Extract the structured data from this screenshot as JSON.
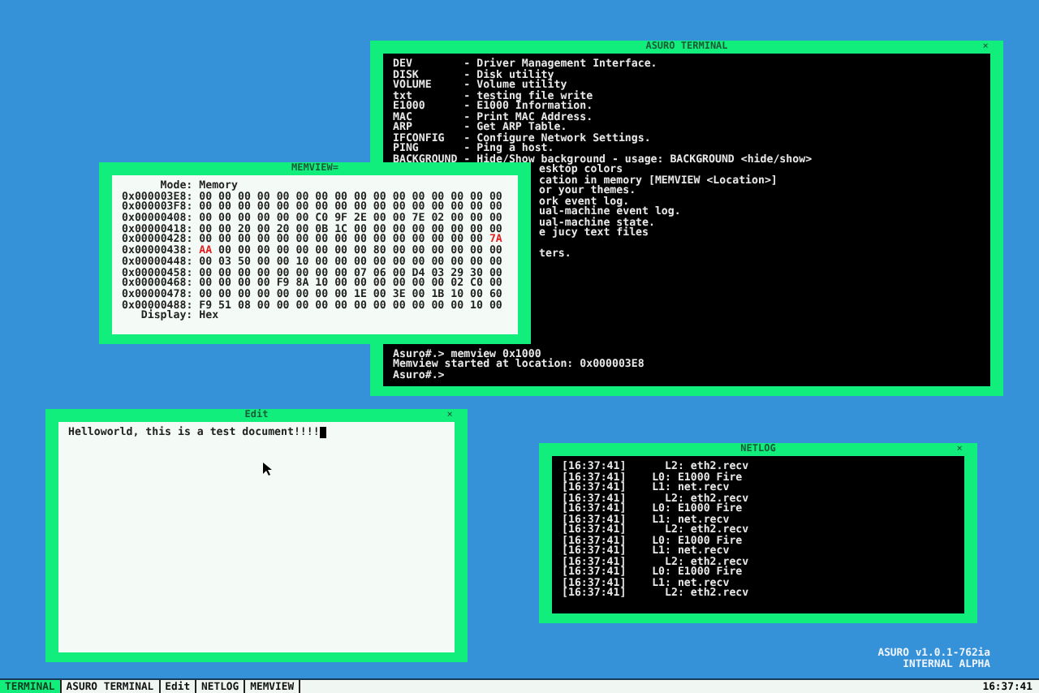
{
  "windows": [
    {
      "kind": "terminal",
      "title": "ASURO TERMINAL",
      "close": "×",
      "lines": [
        {
          "kind": "full",
          "text": "DEV        - Driver Management Interface."
        },
        {
          "kind": "full",
          "text": "DISK       - Disk utility"
        },
        {
          "kind": "full",
          "text": "VOLUME     - Volume utility"
        },
        {
          "kind": "full",
          "text": "txt        - testing file write"
        },
        {
          "kind": "full",
          "text": "E1000      - E1000 Information."
        },
        {
          "kind": "full",
          "text": "MAC        - Print MAC Address."
        },
        {
          "kind": "full",
          "text": "ARP        - Get ARP Table."
        },
        {
          "kind": "full",
          "text": "IFCONFIG   - Configure Network Settings."
        },
        {
          "kind": "full",
          "text": "PING       - Ping a host."
        },
        {
          "kind": "full",
          "text": "BACKGROUND - Hide/Show background - usage: BACKGROUND <hide/show>"
        },
        {
          "kind": "clipped",
          "text": "esktop colors"
        },
        {
          "kind": "clipped",
          "text": "cation in memory [MEMVIEW <Location>]"
        },
        {
          "kind": "clipped",
          "text": "or your themes."
        },
        {
          "kind": "clipped",
          "text": "ork event log."
        },
        {
          "kind": "clipped",
          "text": "ual-machine event log."
        },
        {
          "kind": "clipped",
          "text": "ual-machine state."
        },
        {
          "kind": "clipped",
          "text": "e jucy text files"
        },
        {
          "kind": "blank"
        },
        {
          "kind": "clipped",
          "text": "ters."
        }
      ],
      "prompt_lines": [
        "Asuro#.> memview 0x1000",
        "Memview started at location: 0x000003E8",
        "Asuro#.>"
      ]
    },
    {
      "kind": "memview",
      "title": "MEMVIEW=",
      "mode": {
        "label": "Mode:",
        "value": "Memory"
      },
      "rows": [
        {
          "address": "0x000003E8:",
          "bytes": [
            {
              "v": "00",
              "changed": false
            },
            {
              "v": "00",
              "changed": false
            },
            {
              "v": "00",
              "changed": false
            },
            {
              "v": "00",
              "changed": false
            },
            {
              "v": "00",
              "changed": false
            },
            {
              "v": "00",
              "changed": false
            },
            {
              "v": "00",
              "changed": false
            },
            {
              "v": "00",
              "changed": false
            },
            {
              "v": "00",
              "changed": false
            },
            {
              "v": "00",
              "changed": false
            },
            {
              "v": "00",
              "changed": false
            },
            {
              "v": "00",
              "changed": false
            },
            {
              "v": "00",
              "changed": false
            },
            {
              "v": "00",
              "changed": false
            },
            {
              "v": "00",
              "changed": false
            },
            {
              "v": "00",
              "changed": false
            }
          ]
        },
        {
          "address": "0x000003F8:",
          "bytes": [
            {
              "v": "00",
              "changed": false
            },
            {
              "v": "00",
              "changed": false
            },
            {
              "v": "00",
              "changed": false
            },
            {
              "v": "00",
              "changed": false
            },
            {
              "v": "00",
              "changed": false
            },
            {
              "v": "00",
              "changed": false
            },
            {
              "v": "00",
              "changed": false
            },
            {
              "v": "00",
              "changed": false
            },
            {
              "v": "00",
              "changed": false
            },
            {
              "v": "00",
              "changed": false
            },
            {
              "v": "00",
              "changed": false
            },
            {
              "v": "00",
              "changed": false
            },
            {
              "v": "00",
              "changed": false
            },
            {
              "v": "00",
              "changed": false
            },
            {
              "v": "00",
              "changed": false
            },
            {
              "v": "00",
              "changed": false
            }
          ]
        },
        {
          "address": "0x00000408:",
          "bytes": [
            {
              "v": "00",
              "changed": false
            },
            {
              "v": "00",
              "changed": false
            },
            {
              "v": "00",
              "changed": false
            },
            {
              "v": "00",
              "changed": false
            },
            {
              "v": "00",
              "changed": false
            },
            {
              "v": "00",
              "changed": false
            },
            {
              "v": "C0",
              "changed": false
            },
            {
              "v": "9F",
              "changed": false
            },
            {
              "v": "2E",
              "changed": false
            },
            {
              "v": "00",
              "changed": false
            },
            {
              "v": "00",
              "changed": false
            },
            {
              "v": "7E",
              "changed": false
            },
            {
              "v": "02",
              "changed": false
            },
            {
              "v": "00",
              "changed": false
            },
            {
              "v": "00",
              "changed": false
            },
            {
              "v": "00",
              "changed": false
            }
          ]
        },
        {
          "address": "0x00000418:",
          "bytes": [
            {
              "v": "00",
              "changed": false
            },
            {
              "v": "00",
              "changed": false
            },
            {
              "v": "20",
              "changed": false
            },
            {
              "v": "00",
              "changed": false
            },
            {
              "v": "20",
              "changed": false
            },
            {
              "v": "00",
              "changed": false
            },
            {
              "v": "0B",
              "changed": false
            },
            {
              "v": "1C",
              "changed": false
            },
            {
              "v": "00",
              "changed": false
            },
            {
              "v": "00",
              "changed": false
            },
            {
              "v": "00",
              "changed": false
            },
            {
              "v": "00",
              "changed": false
            },
            {
              "v": "00",
              "changed": false
            },
            {
              "v": "00",
              "changed": false
            },
            {
              "v": "00",
              "changed": false
            },
            {
              "v": "00",
              "changed": false
            }
          ]
        },
        {
          "address": "0x00000428:",
          "bytes": [
            {
              "v": "00",
              "changed": false
            },
            {
              "v": "00",
              "changed": false
            },
            {
              "v": "00",
              "changed": false
            },
            {
              "v": "00",
              "changed": false
            },
            {
              "v": "00",
              "changed": false
            },
            {
              "v": "00",
              "changed": false
            },
            {
              "v": "00",
              "changed": false
            },
            {
              "v": "00",
              "changed": false
            },
            {
              "v": "00",
              "changed": false
            },
            {
              "v": "00",
              "changed": false
            },
            {
              "v": "00",
              "changed": false
            },
            {
              "v": "00",
              "changed": false
            },
            {
              "v": "00",
              "changed": false
            },
            {
              "v": "00",
              "changed": false
            },
            {
              "v": "00",
              "changed": false
            },
            {
              "v": "7A",
              "changed": true
            }
          ]
        },
        {
          "address": "0x00000438:",
          "bytes": [
            {
              "v": "AA",
              "changed": true
            },
            {
              "v": "00",
              "changed": false
            },
            {
              "v": "00",
              "changed": false
            },
            {
              "v": "00",
              "changed": false
            },
            {
              "v": "00",
              "changed": false
            },
            {
              "v": "00",
              "changed": false
            },
            {
              "v": "00",
              "changed": false
            },
            {
              "v": "00",
              "changed": false
            },
            {
              "v": "00",
              "changed": false
            },
            {
              "v": "80",
              "changed": false
            },
            {
              "v": "00",
              "changed": false
            },
            {
              "v": "00",
              "changed": false
            },
            {
              "v": "00",
              "changed": false
            },
            {
              "v": "00",
              "changed": false
            },
            {
              "v": "00",
              "changed": false
            },
            {
              "v": "00",
              "changed": false
            }
          ]
        },
        {
          "address": "0x00000448:",
          "bytes": [
            {
              "v": "00",
              "changed": false
            },
            {
              "v": "03",
              "changed": false
            },
            {
              "v": "50",
              "changed": false
            },
            {
              "v": "00",
              "changed": false
            },
            {
              "v": "00",
              "changed": false
            },
            {
              "v": "10",
              "changed": false
            },
            {
              "v": "00",
              "changed": false
            },
            {
              "v": "00",
              "changed": false
            },
            {
              "v": "00",
              "changed": false
            },
            {
              "v": "00",
              "changed": false
            },
            {
              "v": "00",
              "changed": false
            },
            {
              "v": "00",
              "changed": false
            },
            {
              "v": "00",
              "changed": false
            },
            {
              "v": "00",
              "changed": false
            },
            {
              "v": "00",
              "changed": false
            },
            {
              "v": "00",
              "changed": false
            }
          ]
        },
        {
          "address": "0x00000458:",
          "bytes": [
            {
              "v": "00",
              "changed": false
            },
            {
              "v": "00",
              "changed": false
            },
            {
              "v": "00",
              "changed": false
            },
            {
              "v": "00",
              "changed": false
            },
            {
              "v": "00",
              "changed": false
            },
            {
              "v": "00",
              "changed": false
            },
            {
              "v": "00",
              "changed": false
            },
            {
              "v": "00",
              "changed": false
            },
            {
              "v": "07",
              "changed": false
            },
            {
              "v": "06",
              "changed": false
            },
            {
              "v": "00",
              "changed": false
            },
            {
              "v": "D4",
              "changed": false
            },
            {
              "v": "03",
              "changed": false
            },
            {
              "v": "29",
              "changed": false
            },
            {
              "v": "30",
              "changed": false
            },
            {
              "v": "00",
              "changed": false
            }
          ]
        },
        {
          "address": "0x00000468:",
          "bytes": [
            {
              "v": "00",
              "changed": false
            },
            {
              "v": "00",
              "changed": false
            },
            {
              "v": "00",
              "changed": false
            },
            {
              "v": "00",
              "changed": false
            },
            {
              "v": "F9",
              "changed": false
            },
            {
              "v": "8A",
              "changed": false
            },
            {
              "v": "10",
              "changed": false
            },
            {
              "v": "00",
              "changed": false
            },
            {
              "v": "00",
              "changed": false
            },
            {
              "v": "00",
              "changed": false
            },
            {
              "v": "00",
              "changed": false
            },
            {
              "v": "00",
              "changed": false
            },
            {
              "v": "00",
              "changed": false
            },
            {
              "v": "02",
              "changed": false
            },
            {
              "v": "C0",
              "changed": false
            },
            {
              "v": "00",
              "changed": false
            }
          ]
        },
        {
          "address": "0x00000478:",
          "bytes": [
            {
              "v": "00",
              "changed": false
            },
            {
              "v": "00",
              "changed": false
            },
            {
              "v": "00",
              "changed": false
            },
            {
              "v": "00",
              "changed": false
            },
            {
              "v": "00",
              "changed": false
            },
            {
              "v": "00",
              "changed": false
            },
            {
              "v": "00",
              "changed": false
            },
            {
              "v": "00",
              "changed": false
            },
            {
              "v": "1E",
              "changed": false
            },
            {
              "v": "00",
              "changed": false
            },
            {
              "v": "3E",
              "changed": false
            },
            {
              "v": "00",
              "changed": false
            },
            {
              "v": "1B",
              "changed": false
            },
            {
              "v": "10",
              "changed": false
            },
            {
              "v": "00",
              "changed": false
            },
            {
              "v": "60",
              "changed": false
            }
          ]
        },
        {
          "address": "0x00000488:",
          "bytes": [
            {
              "v": "F9",
              "changed": false
            },
            {
              "v": "51",
              "changed": false
            },
            {
              "v": "08",
              "changed": false
            },
            {
              "v": "00",
              "changed": false
            },
            {
              "v": "00",
              "changed": false
            },
            {
              "v": "00",
              "changed": false
            },
            {
              "v": "00",
              "changed": false
            },
            {
              "v": "00",
              "changed": false
            },
            {
              "v": "00",
              "changed": false
            },
            {
              "v": "00",
              "changed": false
            },
            {
              "v": "00",
              "changed": false
            },
            {
              "v": "00",
              "changed": false
            },
            {
              "v": "00",
              "changed": false
            },
            {
              "v": "00",
              "changed": false
            },
            {
              "v": "10",
              "changed": false
            },
            {
              "v": "00",
              "changed": false
            }
          ]
        }
      ],
      "display": {
        "label": "Display:",
        "value": "Hex"
      }
    },
    {
      "kind": "editor",
      "title": "Edit",
      "close": "×",
      "text": "Helloworld, this is a test document!!!!"
    },
    {
      "kind": "log",
      "title": "NETLOG",
      "close": "×",
      "lines": [
        "[16:37:41]      L2: eth2.recv",
        "[16:37:41]    L0: E1000 Fire",
        "[16:37:41]    L1: net.recv",
        "[16:37:41]      L2: eth2.recv",
        "[16:37:41]    L0: E1000 Fire",
        "[16:37:41]    L1: net.recv",
        "[16:37:41]      L2: eth2.recv",
        "[16:37:41]    L0: E1000 Fire",
        "[16:37:41]    L1: net.recv",
        "[16:37:41]      L2: eth2.recv",
        "[16:37:41]    L0: E1000 Fire",
        "[16:37:41]    L1: net.recv",
        "[16:37:41]      L2: eth2.recv"
      ]
    }
  ],
  "version": [
    "ASURO v1.0.1-762ia",
    "INTERNAL ALPHA"
  ],
  "taskbar": {
    "items": [
      {
        "label": "TERMINAL",
        "selected": true
      },
      {
        "label": "ASURO TERMINAL",
        "selected": false
      },
      {
        "label": "Edit",
        "selected": false
      },
      {
        "label": "NETLOG",
        "selected": false
      },
      {
        "label": "MEMVIEW",
        "selected": false
      }
    ],
    "clock": "16:37:41"
  }
}
